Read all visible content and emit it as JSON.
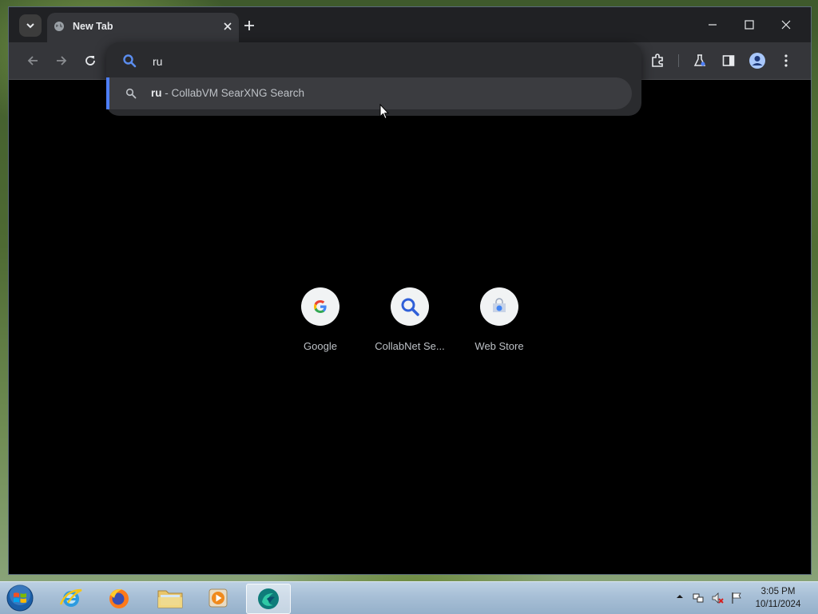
{
  "browser": {
    "tab": {
      "title": "New Tab"
    },
    "omnibox": {
      "value": "ru",
      "suggestion_query": "ru",
      "suggestion_suffix": " - CollabVM SearXNG Search"
    },
    "shortcuts": [
      {
        "label": "Google",
        "icon": "google-g-icon"
      },
      {
        "label": "CollabNet Se...",
        "icon": "magnifier-icon"
      },
      {
        "label": "Web Store",
        "icon": "web-store-icon"
      }
    ],
    "colors": {
      "accent": "#4d7ef7",
      "content_bg": "#000000",
      "chrome_bg": "#202124"
    }
  },
  "taskbar": {
    "apps": [
      "start-orb",
      "internet-explorer",
      "firefox",
      "file-explorer",
      "media-player",
      "browser-app"
    ],
    "clock": {
      "time": "3:05 PM",
      "date": "10/11/2024"
    }
  }
}
